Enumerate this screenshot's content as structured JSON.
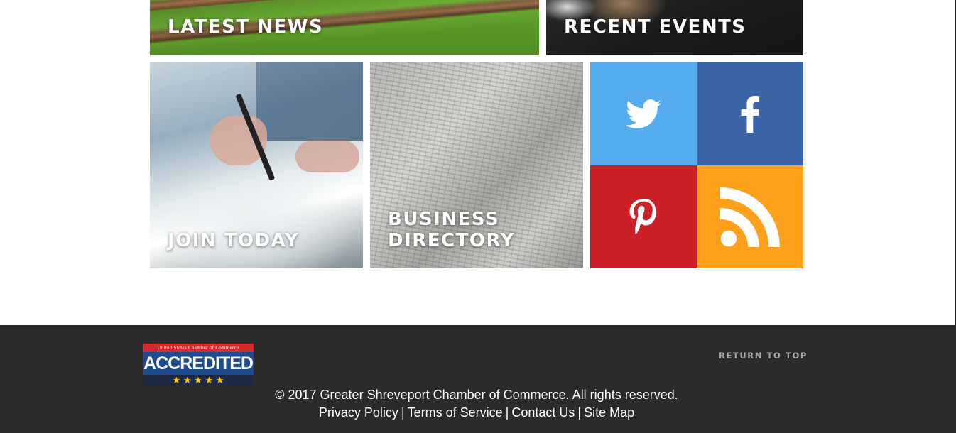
{
  "tiles": {
    "latest_news": "LATEST NEWS",
    "recent_events": "RECENT EVENTS",
    "join_today": "JOIN TODAY",
    "business_directory_line1": "BUSINESS",
    "business_directory_line2": "DIRECTORY"
  },
  "social": [
    {
      "name": "twitter",
      "icon": "twitter-icon",
      "color": "#55acee"
    },
    {
      "name": "facebook",
      "icon": "facebook-icon",
      "color": "#3b65a8"
    },
    {
      "name": "pinterest",
      "icon": "pinterest-icon",
      "color": "#cb2027"
    },
    {
      "name": "rss",
      "icon": "rss-icon",
      "color": "#fda01b"
    }
  ],
  "footer": {
    "badge_top": "United States Chamber of Commerce",
    "badge_main": "ACCREDITED",
    "badge_stars": "★ ★ ★ ★ ★",
    "return_to_top": "RETURN TO TOP",
    "copyright": "© 2017 Greater Shreveport Chamber of Commerce. All rights reserved.",
    "links": [
      "Privacy Policy",
      "Terms of Service",
      "Contact Us",
      "Site Map"
    ],
    "separator": "|",
    "background": "#2b2b2b"
  }
}
